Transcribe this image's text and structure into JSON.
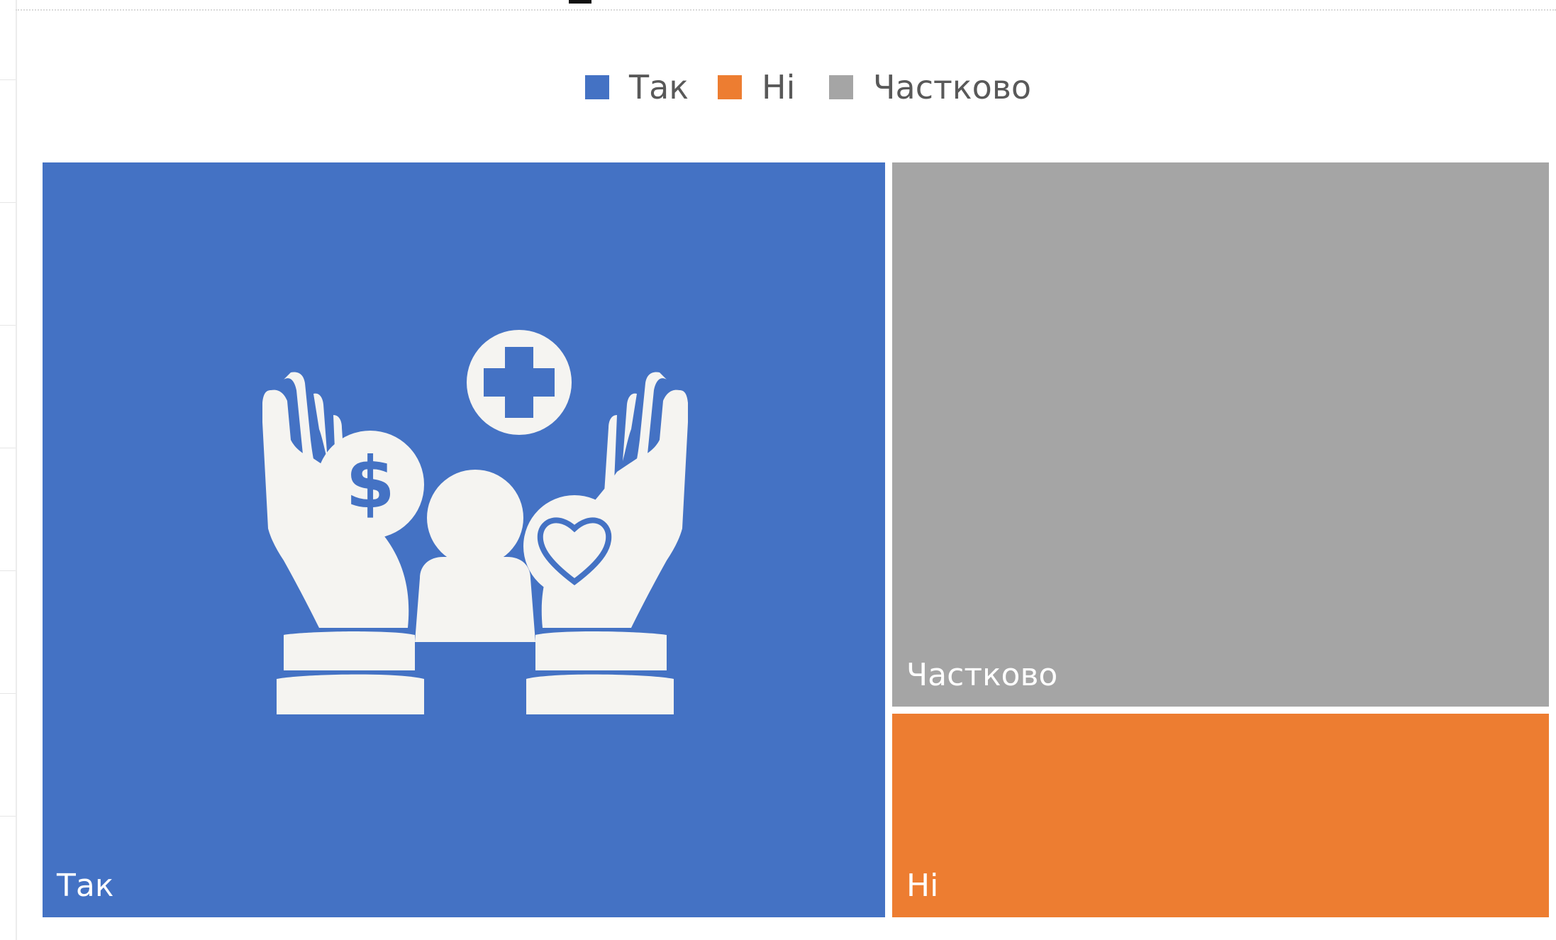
{
  "chart_data": {
    "type": "treemap",
    "categories": [
      "Так",
      "Ні",
      "Частково"
    ],
    "values": [
      60,
      12,
      28
    ],
    "colors": {
      "Так": "#4472C4",
      "Ні": "#ED7D31",
      "Частково": "#A5A5A5"
    },
    "legend": {
      "position": "top",
      "entries": [
        "Так",
        "Ні",
        "Частково"
      ]
    },
    "data_labels": [
      "Так",
      "Ні",
      "Частково"
    ]
  },
  "illustration": {
    "name": "hands-care-icon",
    "color": "#F5F4F1"
  }
}
